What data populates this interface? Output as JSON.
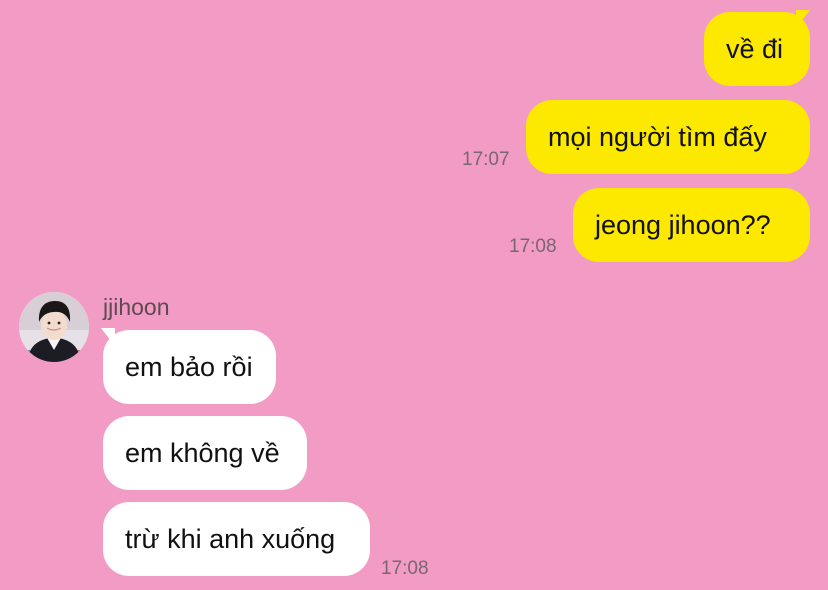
{
  "chat": {
    "outgoing": [
      {
        "text": "về đi",
        "time": ""
      },
      {
        "text": "mọi người tìm đấy",
        "time": "17:07"
      },
      {
        "text": "jeong jihoon??",
        "time": "17:08"
      }
    ],
    "contact": {
      "name": "jjihoon",
      "avatar_icon": "profile-photo"
    },
    "incoming": [
      {
        "text": "em bảo rồi",
        "time": ""
      },
      {
        "text": "em không về",
        "time": ""
      },
      {
        "text": "trừ khi anh xuống",
        "time": "17:08"
      }
    ]
  },
  "colors": {
    "background": "#f29bc4",
    "outgoing_bubble": "#fde800",
    "incoming_bubble": "#ffffff",
    "timestamp": "#7a6670"
  }
}
